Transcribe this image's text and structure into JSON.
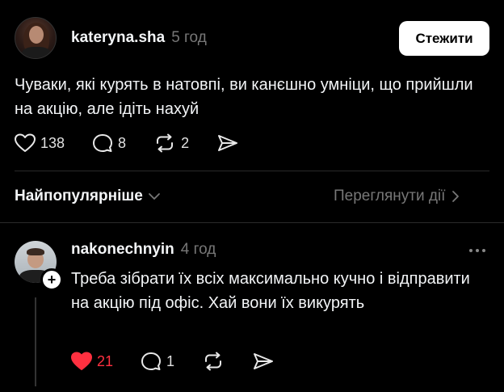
{
  "post": {
    "username": "kateryna.sha",
    "time": "5 год",
    "follow_label": "Стежити",
    "text": "Чуваки, які курять в натовпі, ви канєшно умніци, що прийшли на акцію, але ідіть нахуй",
    "likes": "138",
    "comments": "8",
    "reposts": "2"
  },
  "sort": {
    "label": "Найпопулярніше",
    "activity_label": "Переглянути дії"
  },
  "reply": {
    "username": "nakonechnyin",
    "time": "4 год",
    "text": "Треба зібрати їх всіх максимально кучно і відправити на акцію під офіс. Хай вони їх викурять",
    "likes": "21",
    "comments": "1"
  },
  "colors": {
    "background": "#000000",
    "text": "#f3f5f7",
    "muted": "#777777",
    "liked": "#ff3040"
  },
  "icons": [
    "heart-icon",
    "comment-icon",
    "repost-icon",
    "share-icon",
    "chevron-down-icon",
    "chevron-right-icon",
    "more-icon",
    "plus-icon"
  ]
}
